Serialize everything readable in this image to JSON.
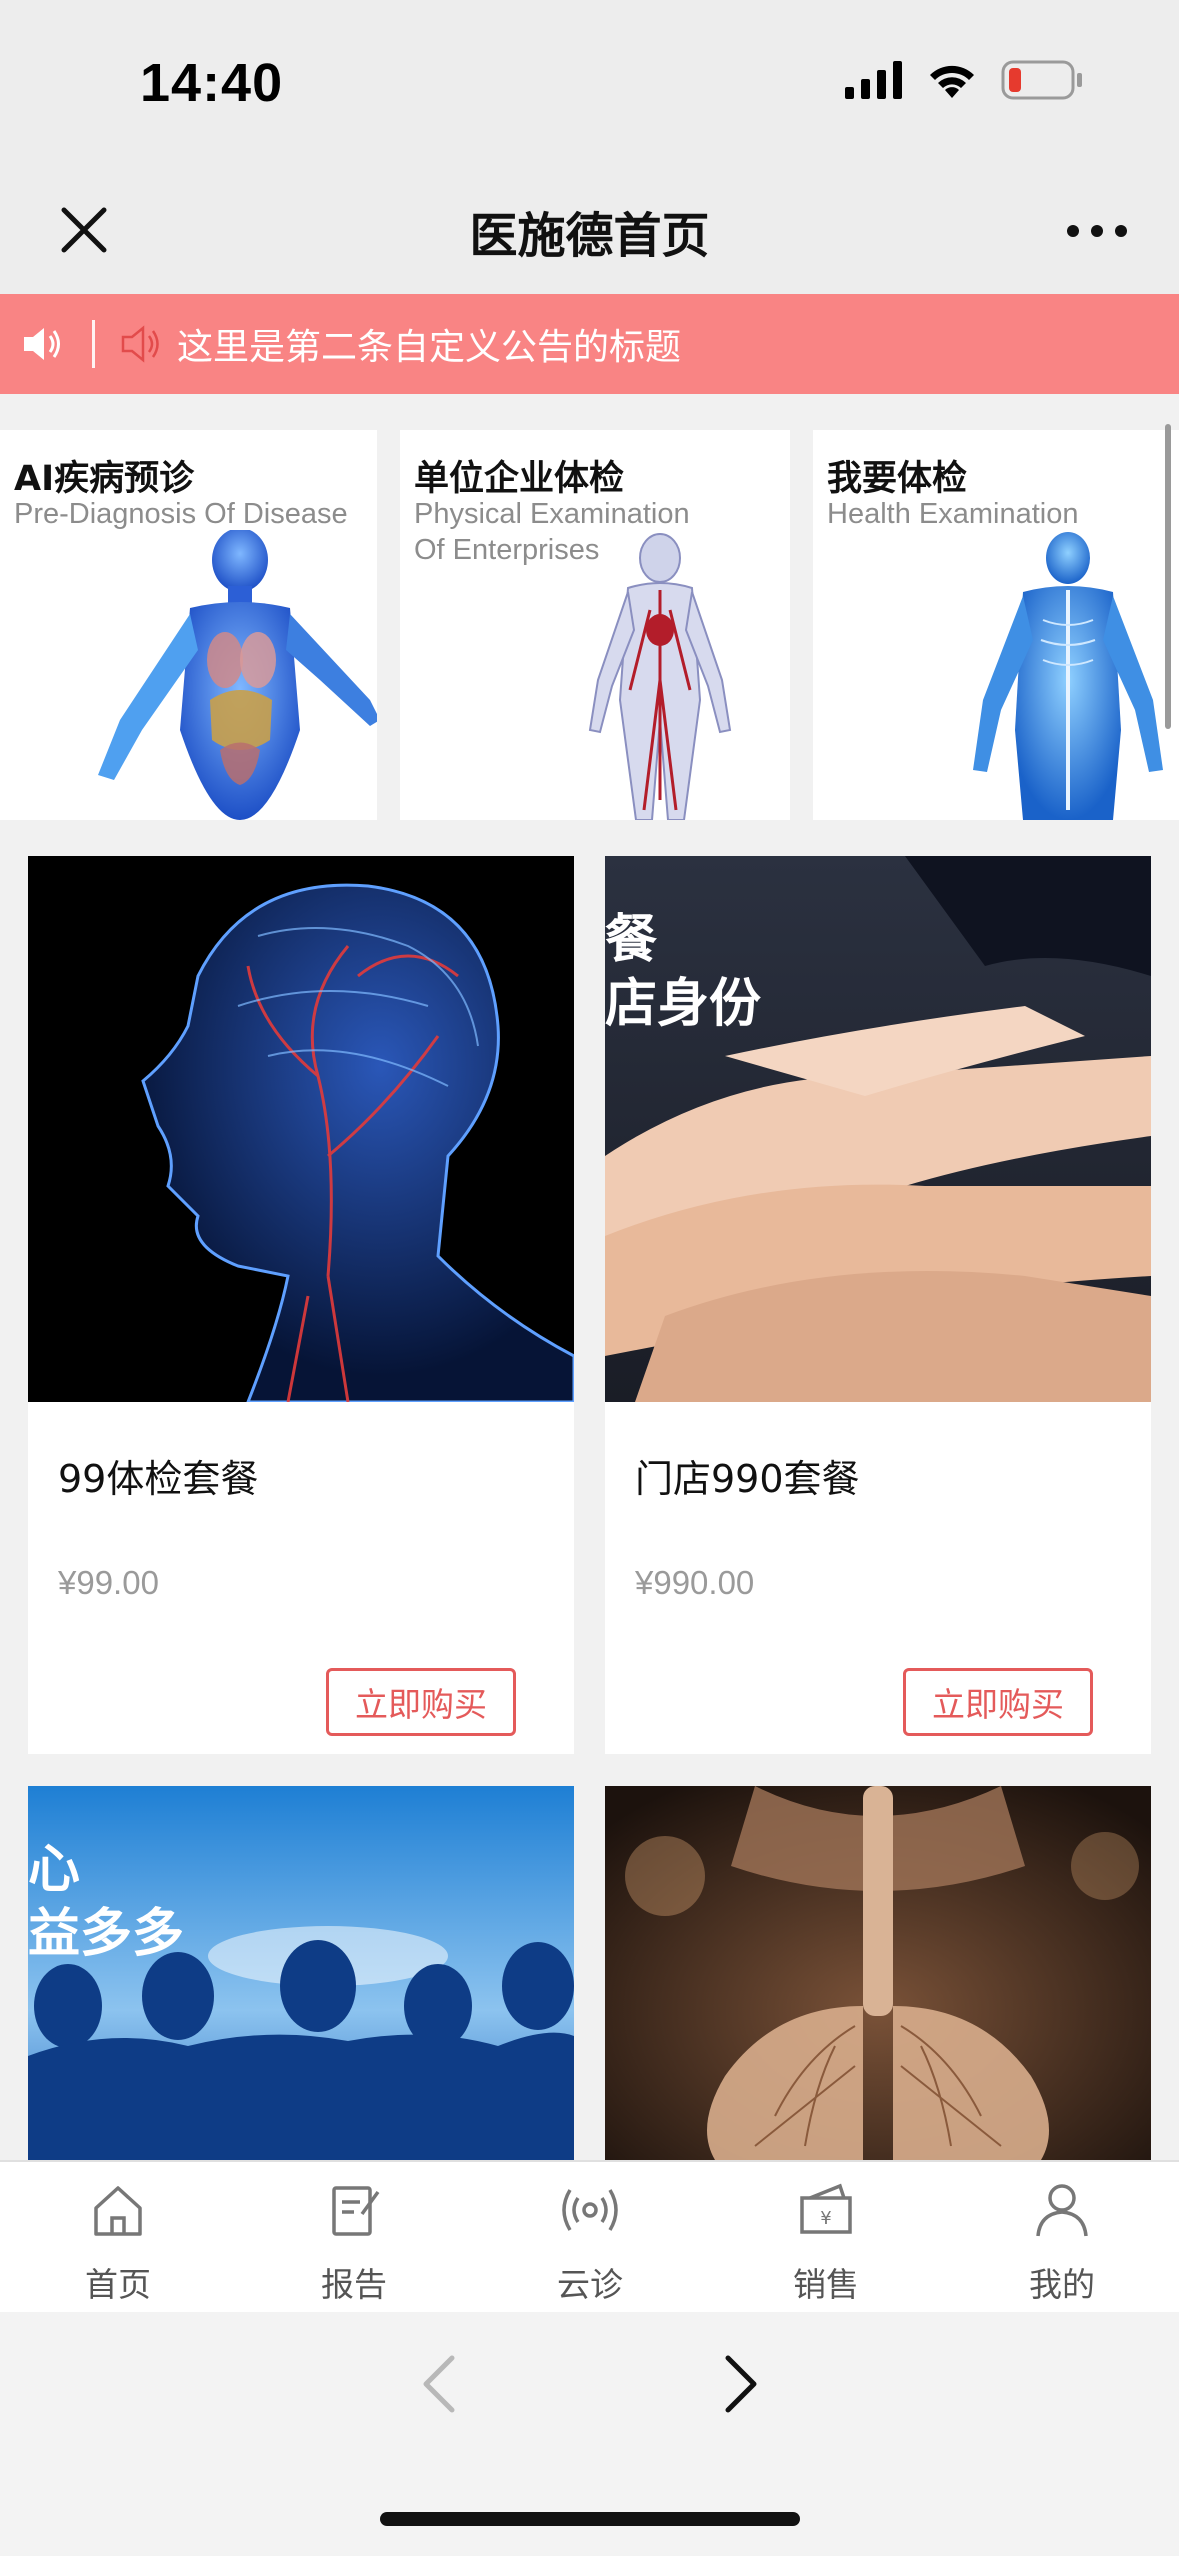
{
  "status_bar": {
    "time": "14:40",
    "icons": [
      "signal-icon",
      "wifi-icon",
      "battery-low-icon"
    ],
    "battery_color": "#e63a2e"
  },
  "nav": {
    "title": "医施德首页",
    "close_icon": "close-icon",
    "more_icon": "more-icon"
  },
  "notice": {
    "text": "这里是第二条自定义公告的标题",
    "background": "#f98484"
  },
  "categories": [
    {
      "title": "AI疾病预诊",
      "subtitle_lines": [
        "Pre-Diagnosis Of Disease"
      ]
    },
    {
      "title": "单位企业体检",
      "subtitle_lines": [
        "Physical Examination",
        "Of Enterprises"
      ]
    },
    {
      "title": "我要体检",
      "subtitle_lines": [
        "Health Examination"
      ]
    }
  ],
  "products": [
    {
      "name": "99体检套餐",
      "price": "¥99.00",
      "buy_label": "立即购买"
    },
    {
      "name": "门店990套餐",
      "price": "¥990.00",
      "buy_label": "立即购买",
      "image_text": [
        "餐",
        "店身份"
      ]
    },
    {
      "image_text": [
        "心",
        "益多多"
      ]
    },
    {}
  ],
  "tabs": [
    {
      "label": "首页",
      "icon": "home-icon"
    },
    {
      "label": "报告",
      "icon": "report-icon"
    },
    {
      "label": "云诊",
      "icon": "broadcast-icon"
    },
    {
      "label": "销售",
      "icon": "wallet-icon"
    },
    {
      "label": "我的",
      "icon": "person-icon"
    }
  ],
  "accent_color": "#e45a5a"
}
